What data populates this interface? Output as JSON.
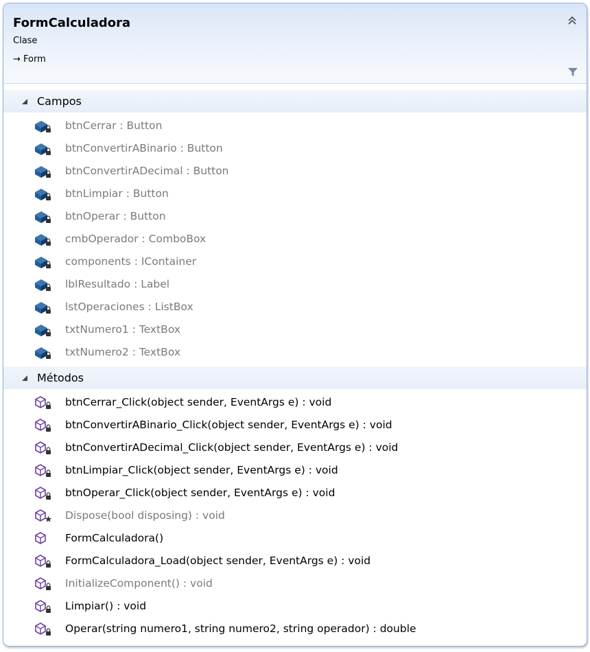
{
  "class_box": {
    "name": "FormCalculadora",
    "stereotype": "Clase",
    "base": "→ Form"
  },
  "sections": {
    "fields_label": "Campos",
    "methods_label": "Métodos"
  },
  "fields": [
    {
      "text": "btnCerrar : Button"
    },
    {
      "text": "btnConvertirABinario : Button"
    },
    {
      "text": "btnConvertirADecimal : Button"
    },
    {
      "text": "btnLimpiar : Button"
    },
    {
      "text": "btnOperar : Button"
    },
    {
      "text": "cmbOperador : ComboBox"
    },
    {
      "text": "components : IContainer"
    },
    {
      "text": "lblResultado : Label"
    },
    {
      "text": "lstOperaciones : ListBox"
    },
    {
      "text": "txtNumero1 : TextBox"
    },
    {
      "text": "txtNumero2 : TextBox"
    }
  ],
  "methods": [
    {
      "text": "btnCerrar_Click(object sender, EventArgs e) : void",
      "access": "private",
      "dim": false
    },
    {
      "text": "btnConvertirABinario_Click(object sender, EventArgs e) : void",
      "access": "private",
      "dim": false
    },
    {
      "text": "btnConvertirADecimal_Click(object sender, EventArgs e) : void",
      "access": "private",
      "dim": false
    },
    {
      "text": "btnLimpiar_Click(object sender, EventArgs e) : void",
      "access": "private",
      "dim": false
    },
    {
      "text": "btnOperar_Click(object sender, EventArgs e) : void",
      "access": "private",
      "dim": false
    },
    {
      "text": "Dispose(bool disposing) : void",
      "access": "protected",
      "dim": true
    },
    {
      "text": "FormCalculadora()",
      "access": "public",
      "dim": false
    },
    {
      "text": "FormCalculadora_Load(object sender, EventArgs e) : void",
      "access": "private",
      "dim": false
    },
    {
      "text": "InitializeComponent() : void",
      "access": "private",
      "dim": true
    },
    {
      "text": "Limpiar() : void",
      "access": "private",
      "dim": false
    },
    {
      "text": "Operar(string numero1, string numero2, string operador) : double",
      "access": "private",
      "dim": false
    }
  ],
  "colors": {
    "field_icon": "#1f5e9e",
    "method_icon": "#6b3fa0",
    "border": "#8db2e3",
    "dim_text": "#7a7a7a"
  }
}
